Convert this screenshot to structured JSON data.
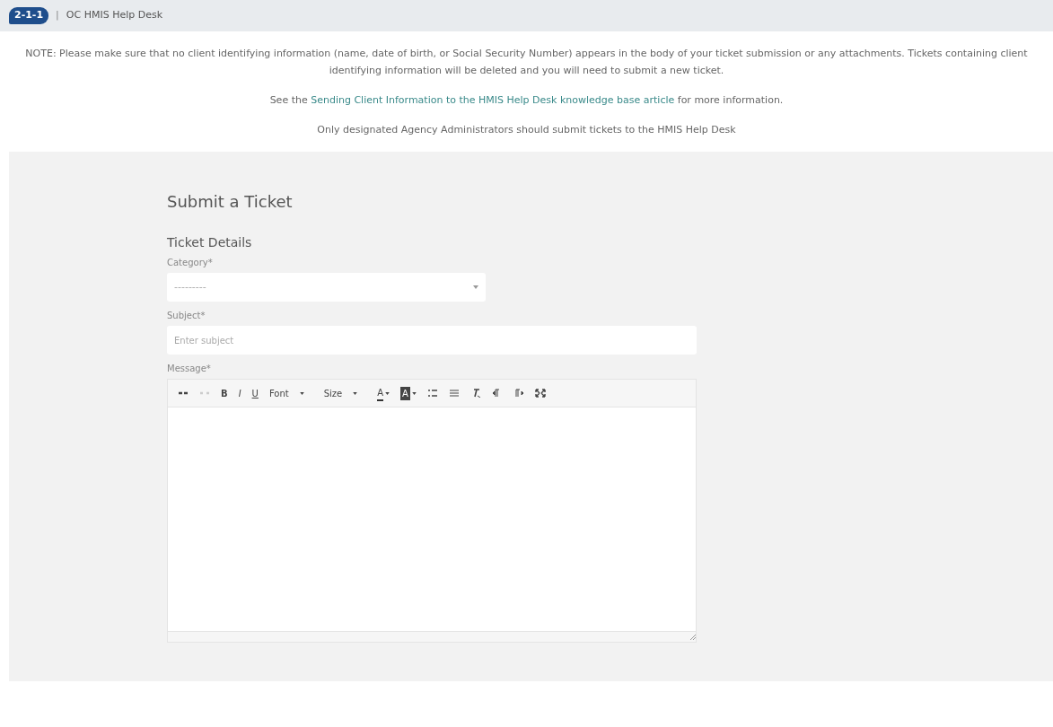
{
  "header": {
    "logo": "2-1-1",
    "separator": "|",
    "title": "OC HMIS Help Desk"
  },
  "notice": {
    "note": "NOTE: Please make sure that no client identifying information (name, date of birth, or Social Security Number) appears in the body of your ticket submission or any attachments. Tickets containing client identifying information will be deleted and you will need to submit a new ticket.",
    "see_before": "See the",
    "link": "Sending Client Information to the HMIS Help Desk knowledge base article",
    "see_after": "for more information.",
    "admins": "Only designated Agency Administrators should submit tickets to the HMIS Help Desk"
  },
  "form": {
    "title": "Submit a Ticket",
    "section": "Ticket Details",
    "category": {
      "label": "Category*",
      "value": "---------"
    },
    "subject": {
      "label": "Subject*",
      "placeholder": "Enter subject"
    },
    "message": {
      "label": "Message*",
      "toolbar": [
        {
          "kind": "link",
          "disabled": false
        },
        {
          "kind": "unlink",
          "disabled": true
        },
        {
          "kind": "bold",
          "label": "B",
          "disabled": false
        },
        {
          "kind": "italic",
          "label": "I",
          "disabled": false
        },
        {
          "kind": "underline",
          "label": "U",
          "disabled": false
        },
        {
          "kind": "dropdown",
          "label": "Font",
          "disabled": false
        },
        {
          "kind": "dropdown",
          "label": "Size",
          "disabled": false
        },
        {
          "kind": "textcolor",
          "label": "A",
          "disabled": false
        },
        {
          "kind": "bgcolor",
          "label": "A",
          "disabled": false
        },
        {
          "kind": "numbered",
          "disabled": false
        },
        {
          "kind": "bulleted",
          "disabled": false
        },
        {
          "kind": "clearformat",
          "disabled": false
        },
        {
          "kind": "ltr",
          "disabled": false
        },
        {
          "kind": "rtl",
          "disabled": false
        },
        {
          "kind": "maximize",
          "disabled": false
        }
      ]
    }
  }
}
